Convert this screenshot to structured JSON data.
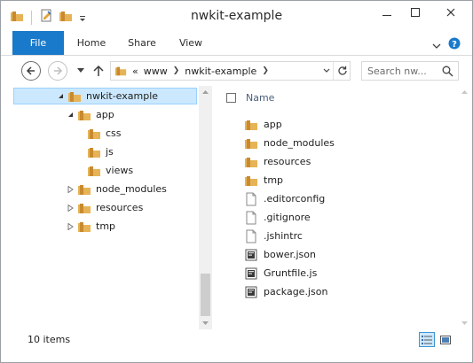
{
  "window": {
    "title": "nwkit-example"
  },
  "ribbon": {
    "tabs": [
      {
        "label": "File"
      },
      {
        "label": "Home"
      },
      {
        "label": "Share"
      },
      {
        "label": "View"
      }
    ]
  },
  "address": {
    "overflow": "«",
    "crumbs": [
      {
        "label": "www"
      },
      {
        "label": "nwkit-example"
      }
    ]
  },
  "search": {
    "placeholder": "Search nw..."
  },
  "nav_tree": [
    {
      "label": "nwkit-example",
      "expanded": true,
      "selected": true
    },
    {
      "label": "app",
      "expanded": true
    },
    {
      "label": "css"
    },
    {
      "label": "js"
    },
    {
      "label": "views"
    },
    {
      "label": "node_modules",
      "expanded": false
    },
    {
      "label": "resources",
      "expanded": false
    },
    {
      "label": "tmp",
      "expanded": false
    }
  ],
  "file_list": {
    "column_name": "Name",
    "items": [
      {
        "name": "app",
        "icon": "folder-icon"
      },
      {
        "name": "node_modules",
        "icon": "folder-icon"
      },
      {
        "name": "resources",
        "icon": "folder-icon"
      },
      {
        "name": "tmp",
        "icon": "folder-icon"
      },
      {
        "name": ".editorconfig",
        "icon": "document-icon"
      },
      {
        "name": ".gitignore",
        "icon": "document-icon"
      },
      {
        "name": ".jshintrc",
        "icon": "document-icon"
      },
      {
        "name": "bower.json",
        "icon": "script-icon"
      },
      {
        "name": "Gruntfile.js",
        "icon": "script-icon"
      },
      {
        "name": "package.json",
        "icon": "script-icon"
      }
    ]
  },
  "status": {
    "item_count": "10 items"
  },
  "colors": {
    "accent": "#1979ca",
    "selection": "#cce8ff",
    "folder": "#d9a441"
  }
}
